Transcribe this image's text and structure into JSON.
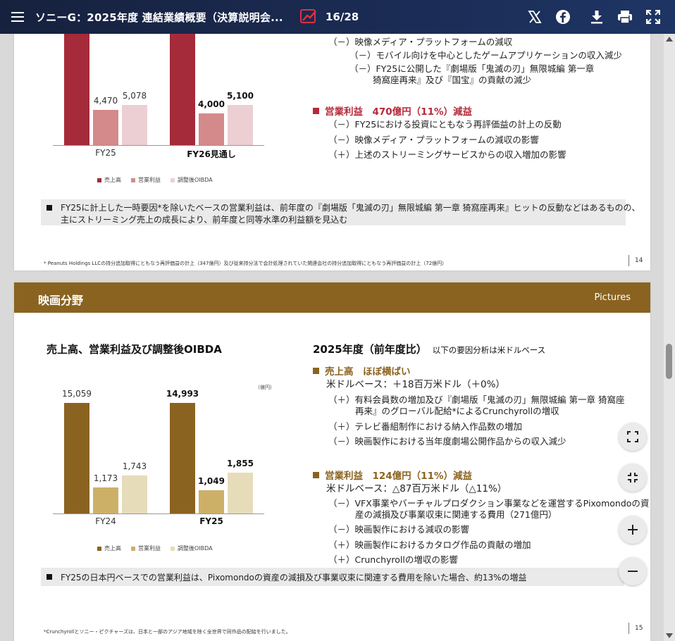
{
  "header": {
    "title": "ソニーG：2025年度 連結業績概要（決算説明会...",
    "page_indicator": "16/28"
  },
  "colors": {
    "header_bg": "#1b2c55",
    "s14_sales": "#a52a3a",
    "s14_op": "#d48a8a",
    "s14_oibda": "#eccfd2",
    "s14_accent": "#b52a3a",
    "s15_banner": "#8a6320",
    "s15_sales": "#8b6320",
    "s15_op": "#cdb068",
    "s15_oibda": "#e6dcba",
    "s15_accent": "#8b6320"
  },
  "slide14": {
    "chart_data": {
      "type": "bar",
      "categories": [
        "FY25",
        "FY26見通し"
      ],
      "series": [
        {
          "name": "売上高",
          "values": [
            null,
            null
          ]
        },
        {
          "name": "営業利益",
          "values": [
            4470,
            4000
          ]
        },
        {
          "name": "調整後OIBDA",
          "values": [
            5078,
            5100
          ]
        }
      ],
      "value_labels": {
        "op": [
          "4,470",
          "4,000"
        ],
        "oibda": [
          "5,078",
          "5,100"
        ]
      }
    },
    "legend": [
      "売上高",
      "営業利益",
      "調整後OIBDA"
    ],
    "right_lines": [
      "（－）映像メディア・プラットフォームの減収",
      "（－）モバイル向けを中心としたゲームアプリケーションの収入減少",
      "（－）FY25に公開した『劇場版「鬼滅の刃」無限城編 第一章",
      "猗窩座再来』及び『国宝』の貢献の減少"
    ],
    "op_heading": "営業利益　470億円（11%）減益",
    "op_lines": [
      "（－）FY25における投資にともなう再評価益の計上の反動",
      "（－）映像メディア・プラットフォームの減収の影響",
      "（＋）上述のストリーミングサービスからの収入増加の影響"
    ],
    "note_line1": "FY25に計上した一時要因*を除いたベースの営業利益は、前年度の『劇場版「鬼滅の刃」無限城編 第一章 猗窩座再来』ヒットの反動などはあるものの、",
    "note_line2": "主にストリーミング売上の成長により、前年度と同等水準の利益額を見込む",
    "footnote": "* Peanuts Holdings LLCの持分追加取得にともなう再評価益の計上（347億円）及び従来持分法で会計処理されていた関連会社の持分追加取得にともなう再評価益の計上（72億円）",
    "page": "14"
  },
  "slide15": {
    "banner_title": "映画分野",
    "banner_sub": "Pictures",
    "chart_title": "売上高、営業利益及び調整後OIBDA",
    "unit": "（億円）",
    "chart_data": {
      "type": "bar",
      "categories": [
        "FY24",
        "FY25"
      ],
      "series": [
        {
          "name": "売上高",
          "values": [
            15059,
            14993
          ]
        },
        {
          "name": "営業利益",
          "values": [
            1173,
            1049
          ]
        },
        {
          "name": "調整後OIBDA",
          "values": [
            1743,
            1855
          ]
        }
      ],
      "value_labels": {
        "sales": [
          "15,059",
          "14,993"
        ],
        "op": [
          "1,173",
          "1,049"
        ],
        "oibda": [
          "1,743",
          "1,855"
        ]
      }
    },
    "legend": [
      "売上高",
      "営業利益",
      "調整後OIBDA"
    ],
    "right_title": "2025年度（前年度比）",
    "right_title_note": "以下の要因分析は米ドルベース",
    "sales_heading": "売上高　ほぼ横ばい",
    "sales_usd": "米ドルベース：＋18百万米ドル（＋0%）",
    "sales_lines": [
      "（＋）有料会員数の増加及び『劇場版「鬼滅の刃」無限城編 第一章 猗窩座",
      "再来』のグローバル配給*によるCrunchyrollの増収",
      "（＋）テレビ番組制作における納入作品数の増加",
      "（－）映画製作における当年度劇場公開作品からの収入減少"
    ],
    "op_heading": "営業利益　124億円（11%）減益",
    "op_usd": "米ドルベース：△87百万米ドル（△11%）",
    "op_lines": [
      "（－）VFX事業やバーチャルプロダクション事業などを運営するPixomondoの資",
      "産の減損及び事業収束に関連する費用（271億円）",
      "（－）映画製作における減収の影響",
      "（＋）映画製作におけるカタログ作品の貢献の増加",
      "（＋）Crunchyrollの増収の影響"
    ],
    "note": "FY25の日本円ベースでの営業利益は、Pixomondoの資産の減損及び事業収束に関連する費用を除いた場合、約13%の増益",
    "footnote": "*Crunchyrollとソニー・ピクチャーズは、日本と一部のアジア地域を除く全世界で同作品の配給を行いました。",
    "page": "15"
  }
}
